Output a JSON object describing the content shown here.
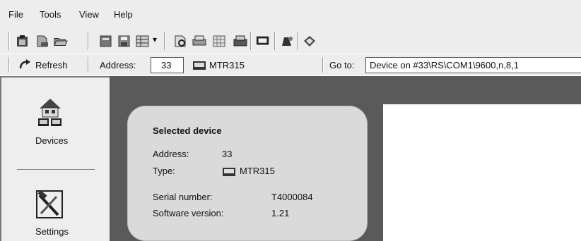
{
  "menu": {
    "file": "File",
    "tools": "Tools",
    "view": "View",
    "help": "Help"
  },
  "toolbar": {
    "icons": [
      "clipboard-icon",
      "new-document-icon",
      "open-folder-icon",
      "document-icon",
      "save-icon",
      "table-icon",
      "dropdown-arrow-icon",
      "preview-icon",
      "print-icon",
      "grid-icon",
      "printer-icon",
      "monitor-icon",
      "gear-bell-icon",
      "diamond-tool-icon"
    ],
    "dropdown_arrow": "▾"
  },
  "addressbar": {
    "refresh_label": "Refresh",
    "address_label": "Address:",
    "address_value": "33",
    "device_type": "MTR315",
    "goto_label": "Go to:",
    "goto_value": "Device on #33\\RS\\COM1\\9600,n,8,1"
  },
  "sidebar": {
    "items": [
      {
        "label": "Devices",
        "icon": "devices-icon"
      },
      {
        "label": "Settings",
        "icon": "settings-icon"
      }
    ]
  },
  "device_card": {
    "title": "Selected device",
    "address_label": "Address:",
    "address_value": "33",
    "type_label": "Type:",
    "type_value": "MTR315",
    "serial_label": "Serial number:",
    "serial_value": "T4000084",
    "software_label": "Software version:",
    "software_value": "1.21"
  }
}
